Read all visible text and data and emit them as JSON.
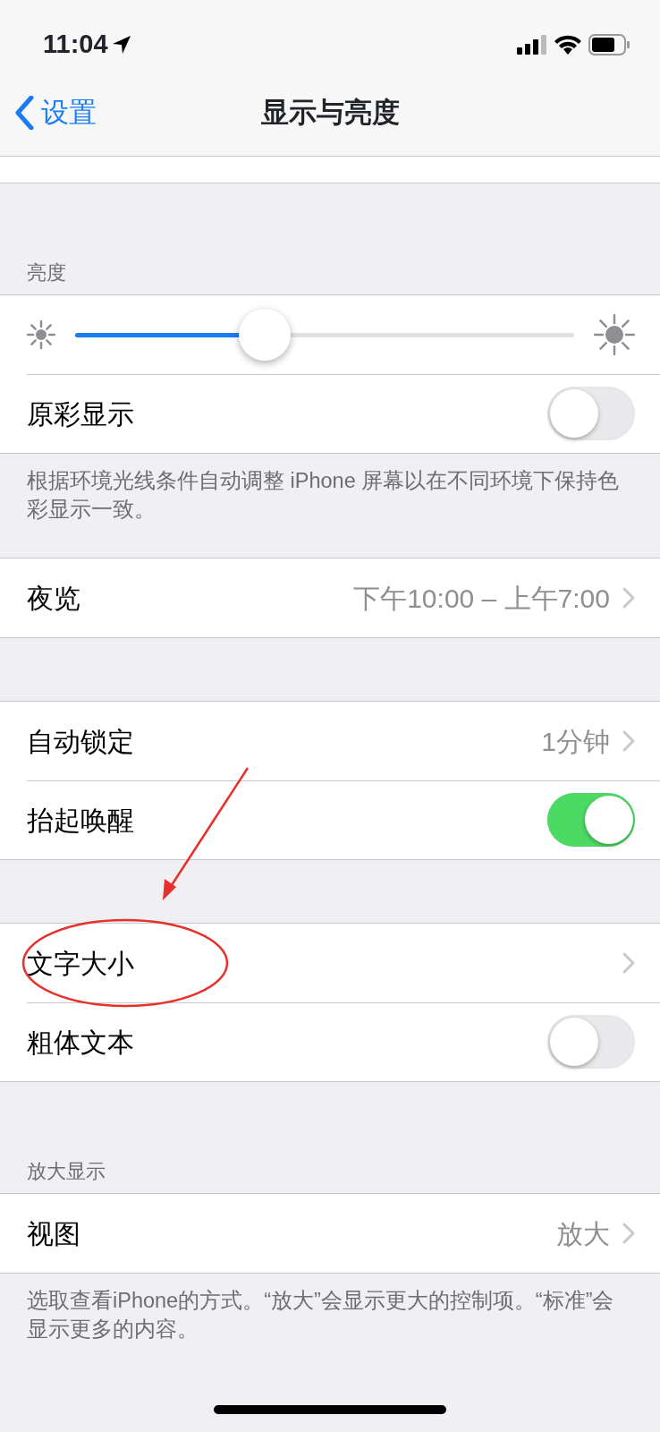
{
  "status_bar": {
    "time": "11:04"
  },
  "nav": {
    "back": "设置",
    "title": "显示与亮度"
  },
  "sections": [
    {
      "header": "亮度",
      "rows": [
        {
          "kind": "slider",
          "level": 0.38
        },
        {
          "kind": "toggle",
          "label": "原彩显示",
          "on": false
        }
      ],
      "footer": "根据环境光线条件自动调整 iPhone 屏幕以在不同环境下保持色彩显示一致。"
    },
    {
      "rows": [
        {
          "kind": "link",
          "label": "夜览",
          "value": "下午10:00 – 上午7:00"
        }
      ]
    },
    {
      "rows": [
        {
          "kind": "link",
          "label": "自动锁定",
          "value": "1分钟"
        },
        {
          "kind": "toggle",
          "label": "抬起唤醒",
          "on": true
        }
      ]
    },
    {
      "rows": [
        {
          "kind": "link",
          "label": "文字大小"
        },
        {
          "kind": "toggle",
          "label": "粗体文本",
          "on": false
        }
      ]
    },
    {
      "header": "放大显示",
      "rows": [
        {
          "kind": "link",
          "label": "视图",
          "value": "放大"
        }
      ],
      "footer": "选取查看iPhone的方式。“放大”会显示更大的控制项。“标准”会显示更多的内容。"
    }
  ],
  "annotations": [
    {
      "kind": "arrow"
    },
    {
      "kind": "ellipse"
    }
  ]
}
